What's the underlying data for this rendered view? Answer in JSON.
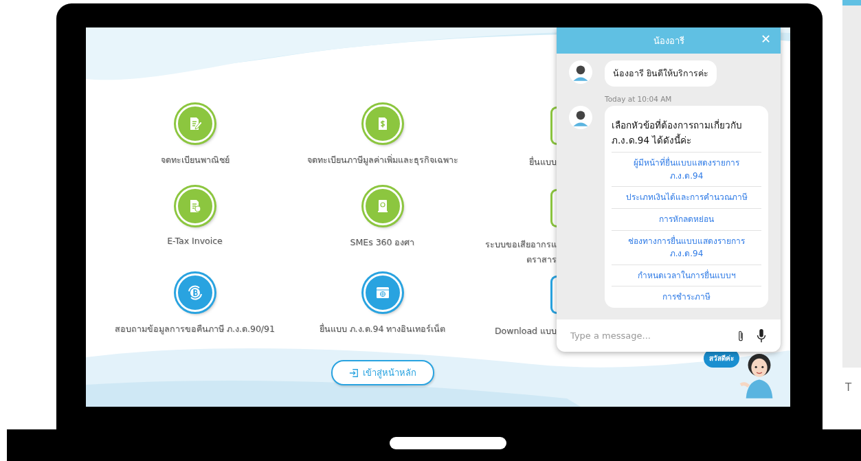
{
  "services": [
    {
      "label": "จดทะเบียนพาณิชย์",
      "kind": "document-pen",
      "color": "#8cc63f"
    },
    {
      "label": "จดทะเบียนภาษีมูลค่าเพิ่มและธุรกิจเฉพาะ",
      "kind": "dollar-document",
      "color": "#8cc63f"
    },
    {
      "label": "E-Tax Invoice",
      "kind": "invoice-document",
      "color": "#8cc63f"
    },
    {
      "label": "SMEs 360 องศา",
      "kind": "book",
      "color": "#8cc63f"
    },
    {
      "label": "สอบถามข้อมูลการขอคืนภาษี ภ.ง.ด.90/91",
      "kind": "baht-cycle",
      "color": "#29a3e0"
    },
    {
      "label": "ยื่นแบบ ภ.ง.ด.94 ทางอินเทอร์เน็ต",
      "kind": "browser-globe",
      "color": "#29a3e0"
    }
  ],
  "partly_hidden_services": [
    {
      "lines": [
        "ยื่นแบบ"
      ],
      "color": "#8cc63f"
    },
    {
      "lines": [
        "ระบบขอเสียอากรแ",
        "ตราสาร"
      ],
      "color": "#8cc63f"
    },
    {
      "lines": [
        "Download แบบ"
      ],
      "color": "#29a3e0"
    }
  ],
  "home_button": "เข้าสู่หน้าหลัก",
  "chat": {
    "title": "น้องอารี",
    "close": "✕",
    "greeting": "น้องอารี ยินดีให้บริการค่ะ",
    "timestamp": "Today at 10:04 AM",
    "prompt": "เลือกหัวข้อที่ต้องการถามเกี่ยวกับ ภ.ง.ด.94 ได้ดังนี้ค่ะ",
    "options": [
      {
        "lines": [
          "ผู้มีหน้าที่ยื่นแบบแสดงรายการ",
          "ภ.ง.ด.94"
        ]
      },
      {
        "lines": [
          "ประเภทเงินได้และการคำนวณภาษี"
        ]
      },
      {
        "lines": [
          "การหักลดหย่อน"
        ]
      },
      {
        "lines": [
          "ช่องทางการยื่นแบบแสดงรายการ",
          "ภ.ง.ด.94"
        ]
      },
      {
        "lines": [
          "กำหนดเวลาในการยื่นแบบฯ"
        ]
      },
      {
        "lines": [
          "การชำระภาษี"
        ]
      }
    ],
    "input": {
      "placeholder": "Type a message..."
    }
  },
  "mascot_bubble": "สวัสดีค่ะ",
  "side_panel": {
    "text": "T"
  }
}
